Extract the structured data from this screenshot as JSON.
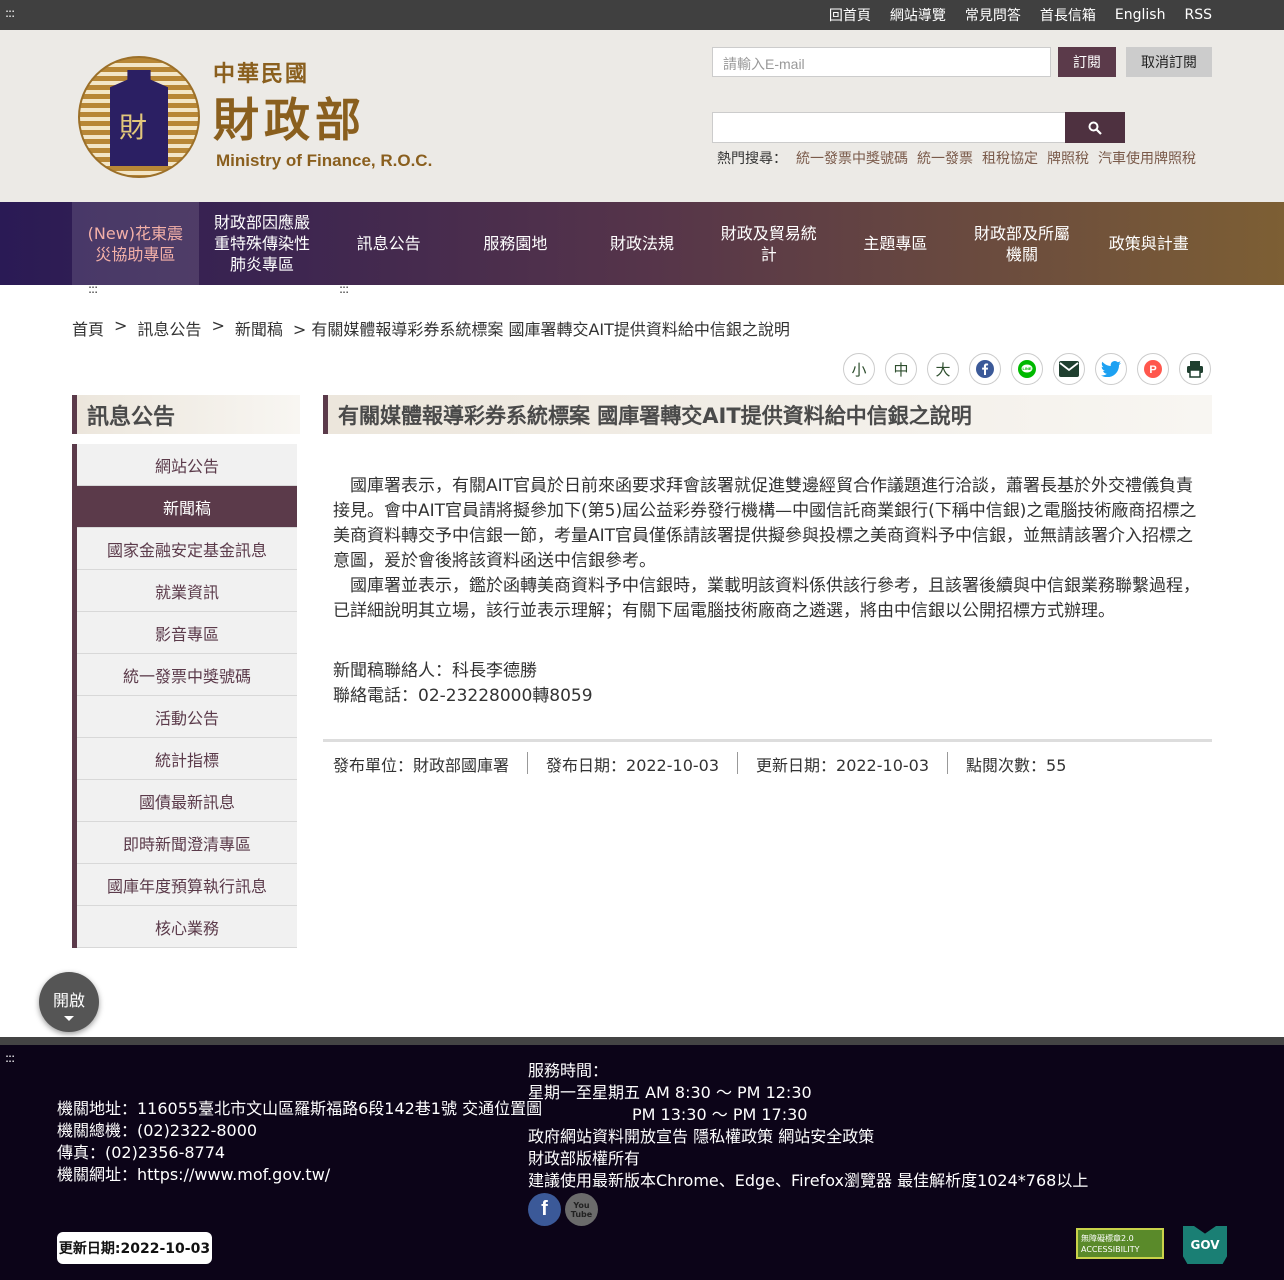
{
  "topbar": {
    "accesskey": ":::",
    "links": [
      "回首頁",
      "網站導覽",
      "常見問答",
      "首長信箱",
      "English",
      "RSS"
    ]
  },
  "logo": {
    "emblem_glyph": "財",
    "line1": "中華民國",
    "line2": "財政部",
    "line3": "Ministry of Finance, R.O.C."
  },
  "subscribe": {
    "email_placeholder": "請輸入E-mail",
    "subscribe_label": "訂閱",
    "unsubscribe_label": "取消訂閱"
  },
  "search": {
    "button_icon": "search-icon",
    "hot_label": "熱門搜尋：",
    "hot_keywords": [
      "統一發票中獎號碼",
      "統一發票",
      "租稅協定",
      "牌照稅",
      "汽車使用牌照稅"
    ]
  },
  "nav": {
    "items": [
      "(New)花東震災協助專區",
      "財政部因應嚴重特殊傳染性肺炎專區",
      "訊息公告",
      "服務園地",
      "財政法規",
      "財政及貿易統計",
      "主題專區",
      "財政部及所屬機關",
      "政策與計畫"
    ]
  },
  "accesskeys": {
    "left": ":::",
    "center": ":::"
  },
  "breadcrumb": {
    "home": "首頁",
    "sep": ">",
    "level1": "訊息公告",
    "level2": "新聞稿",
    "current": "> 有關媒體報導彩券系統標案 國庫署轉交AIT提供資料給中信銀之說明"
  },
  "tools": {
    "font_small": "小",
    "font_medium": "中",
    "font_large": "大",
    "icons": [
      "facebook-icon",
      "line-icon",
      "email-icon",
      "twitter-icon",
      "plurk-icon",
      "print-icon"
    ]
  },
  "sidebar": {
    "title": "訊息公告",
    "items": [
      "網站公告",
      "新聞稿",
      "國家金融安定基金訊息",
      "就業資訊",
      "影音專區",
      "統一發票中獎號碼",
      "活動公告",
      "統計指標",
      "國債最新訊息",
      "即時新聞澄清專區",
      "國庫年度預算執行訊息",
      "核心業務"
    ],
    "active_index": 1
  },
  "article": {
    "title": "有關媒體報導彩券系統標案 國庫署轉交AIT提供資料給中信銀之說明",
    "para1": "國庫署表示，有關AIT官員於日前來函要求拜會該署就促進雙邊經貿合作議題進行洽談，蕭署長基於外交禮儀負責接見。會中AIT官員請將擬參加下(第5)屆公益彩券發行機構—中國信託商業銀行(下稱中信銀)之電腦技術廠商招標之美商資料轉交予中信銀一節，考量AIT官員僅係請該署提供擬參與投標之美商資料予中信銀，並無請該署介入招標之意圖，爰於會後將該資料函送中信銀參考。",
    "para2": "國庫署並表示，鑑於函轉美商資料予中信銀時，業載明該資料係供該行參考，且該署後續與中信銀業務聯繫過程，已詳細說明其立場，該行並表示理解；有關下屆電腦技術廠商之遴選，將由中信銀以公開招標方式辦理。",
    "contact_person": "新聞稿聯絡人：科長李德勝",
    "contact_phone": "聯絡電話：02-23228000轉8059"
  },
  "meta": {
    "unit": "發布單位：財政部國庫署",
    "publish_date": "發布日期：2022-10-03",
    "update_date": "更新日期：2022-10-03",
    "views": "點閱次數：55"
  },
  "toggle": {
    "label": "開啟"
  },
  "footer": {
    "accesskey": ":::",
    "address": "機關地址：116055臺北市文山區羅斯福路6段142巷1號 交通位置圖",
    "phone": "機關總機：(02)2322-8000",
    "fax": "傳真：(02)2356-8774",
    "url": "機關網址：https://www.mof.gov.tw/",
    "hours_title": "服務時間：",
    "hours1": "星期一至星期五 AM 8:30 ～ PM 12:30",
    "hours2": "PM 13:30 ～ PM 17:30",
    "policy_open": "政府網站資料開放宣告",
    "policy_privacy": "隱私權政策",
    "policy_security": "網站安全政策",
    "copyright": "財政部版權所有",
    "browser": "建議使用最新版本Chrome、Edge、Firefox瀏覽器 最佳解析度1024*768以上",
    "social_facebook": "f",
    "social_youtube": "You Tube",
    "update": "更新日期:2022-10-03",
    "badge_accessibility": "無障礙標章2.0 ACCESSIBILITY",
    "badge_gov": "GOV"
  },
  "colors": {
    "brand": "#5b3a4a",
    "topbar": "#404040",
    "header_bg": "#eceae6",
    "footer_bg": "#0c0418"
  }
}
